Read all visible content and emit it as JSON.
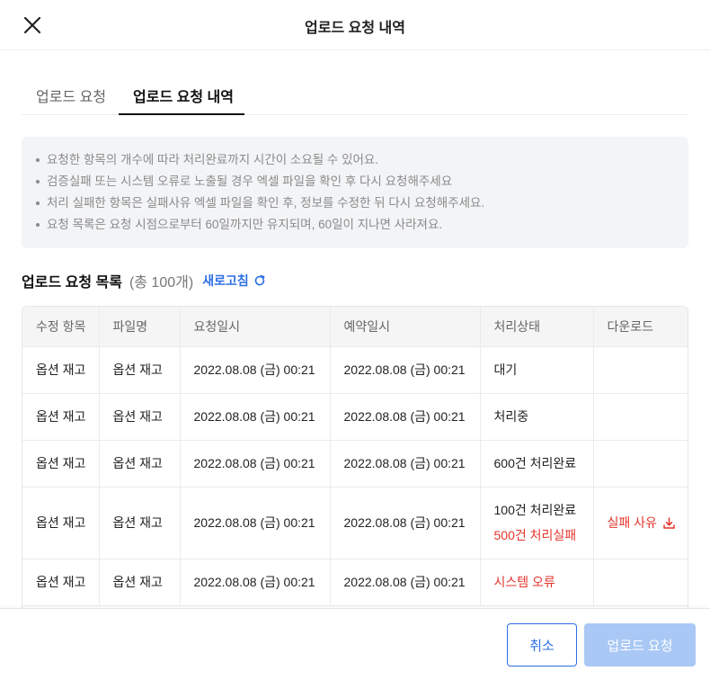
{
  "header": {
    "title": "업로드 요청 내역",
    "close_icon": "close-icon"
  },
  "tabs": [
    {
      "label": "업로드 요청",
      "active": false
    },
    {
      "label": "업로드 요청 내역",
      "active": true
    }
  ],
  "notice": [
    "요청한 항목의 개수에 따라 처리완료까지 시간이 소요될 수 있어요.",
    "검증실패 또는 시스템 오류로 노출될 경우 엑셀 파일을 확인 후 다시 요청해주세요",
    "처리 실패한 항목은 실패사유 엑셀 파일을 확인 후, 정보를 수정한 뒤 다시 요청해주세요.",
    "요청 목록은 요청 시점으로부터 60일까지만 유지되며, 60일이 지나면 사라져요."
  ],
  "list": {
    "title": "업로드 요청 목록",
    "count": "(총 100개)",
    "refresh_label": "새로고침",
    "refresh_icon": "refresh-icon"
  },
  "table": {
    "columns": [
      "수정 항목",
      "파일명",
      "요청일시",
      "예약일시",
      "처리상태",
      "다운로드"
    ],
    "rows": [
      {
        "item": "옵션 재고",
        "file": "옵션 재고",
        "requested": "2022.08.08 (금) 00:21",
        "reserved": "2022.08.08 (금) 00:21",
        "status": "대기",
        "status2": "",
        "download": ""
      },
      {
        "item": "옵션 재고",
        "file": "옵션 재고",
        "requested": "2022.08.08 (금) 00:21",
        "reserved": "2022.08.08 (금) 00:21",
        "status": "처리중",
        "status2": "",
        "download": ""
      },
      {
        "item": "옵션 재고",
        "file": "옵션 재고",
        "requested": "2022.08.08 (금) 00:21",
        "reserved": "2022.08.08 (금) 00:21",
        "status": "600건 처리완료",
        "status2": "",
        "download": ""
      },
      {
        "item": "옵션 재고",
        "file": "옵션 재고",
        "requested": "2022.08.08 (금) 00:21",
        "reserved": "2022.08.08 (금) 00:21",
        "status": "100건 처리완료",
        "status2": "500건 처리실패",
        "download": "실패 사유"
      },
      {
        "item": "옵션 재고",
        "file": "옵션 재고",
        "requested": "2022.08.08 (금) 00:21",
        "reserved": "2022.08.08 (금) 00:21",
        "status": "시스템 오류",
        "status2": "",
        "download": ""
      }
    ]
  },
  "footer": {
    "cancel_label": "취소",
    "submit_label": "업로드 요청"
  },
  "colors": {
    "accent": "#2d6fe3",
    "error": "#e5352d",
    "disabled": "#a9c8f5"
  }
}
